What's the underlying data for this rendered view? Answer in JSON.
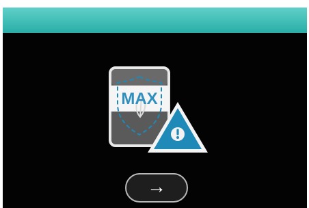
{
  "screen": {
    "icon": {
      "name": "max-shield-warning-icon",
      "label": "MAX"
    },
    "next_button": {
      "icon": "arrow-right-icon",
      "glyph": "→"
    }
  },
  "colors": {
    "header": "#29aea7",
    "accent": "#1f89b8",
    "warning_fill": "#1f89b8",
    "background": "#030303"
  }
}
